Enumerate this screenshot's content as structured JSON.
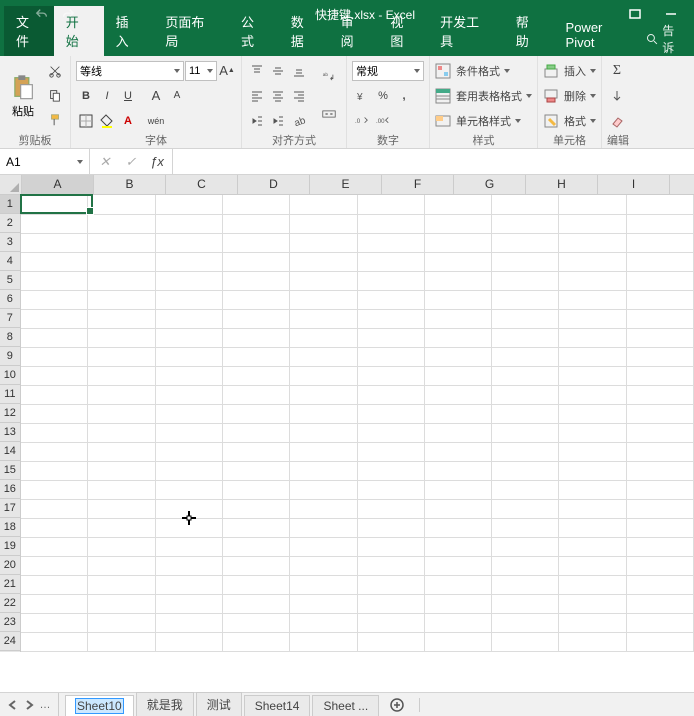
{
  "titlebar": {
    "filename": "快捷键.xlsx",
    "app": "Excel",
    "sep": " - "
  },
  "tabs": {
    "file": "文件",
    "home": "开始",
    "insert": "插入",
    "layout": "页面布局",
    "formulas": "公式",
    "data": "数据",
    "review": "审阅",
    "view": "视图",
    "dev": "开发工具",
    "help": "帮助",
    "pp": "Power Pivot",
    "tellme": "告诉"
  },
  "ribbon": {
    "clipboard": {
      "paste": "粘贴",
      "label": "剪贴板"
    },
    "font": {
      "name": "等线",
      "size": "11",
      "label": "字体",
      "phonetic": "wén"
    },
    "align": {
      "label": "对齐方式"
    },
    "number": {
      "format": "常规",
      "label": "数字"
    },
    "styles": {
      "cond_fmt": "条件格式",
      "fmt_table": "套用表格格式",
      "cell_styles": "单元格样式",
      "label": "样式"
    },
    "cells": {
      "insert": "插入",
      "delete": "删除",
      "format": "格式",
      "label": "单元格"
    },
    "editing": {
      "label": "编辑"
    }
  },
  "namebox": {
    "ref": "A1"
  },
  "columns": [
    "A",
    "B",
    "C",
    "D",
    "E",
    "F",
    "G",
    "H",
    "I"
  ],
  "rows": [
    1,
    2,
    3,
    4,
    5,
    6,
    7,
    8,
    9,
    10,
    11,
    12,
    13,
    14,
    15,
    16,
    17,
    18,
    19,
    20,
    21,
    22,
    23,
    24
  ],
  "sheets": {
    "editing": "Sheet10",
    "tabs": [
      "就是我",
      "测试",
      "Sheet14",
      "Sheet ..."
    ]
  }
}
